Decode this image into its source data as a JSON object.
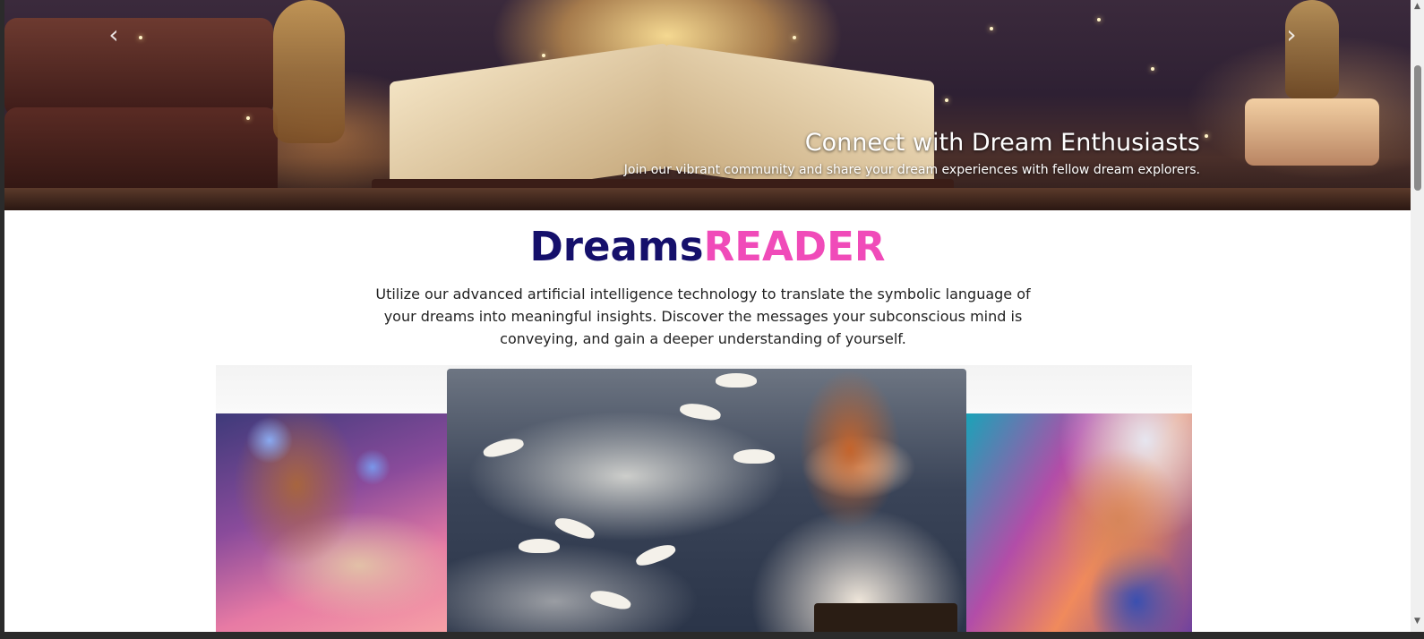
{
  "hero": {
    "prev_arrow": "‹",
    "next_arrow": "›",
    "caption_title": "Connect with Dream Enthusiasts",
    "caption_text": "Join our vibrant community and share your dream experiences with fellow dream explorers."
  },
  "brand": {
    "part1": "Dreams",
    "part2": "READER",
    "color_part1": "#15106b",
    "color_part2": "#f04bb9"
  },
  "intro": {
    "text": "Utilize our advanced artificial intelligence technology to translate the symbolic language of your dreams into meaningful insights. Discover the messages your subconscious mind is conveying, and gain a deeper understanding of yourself."
  },
  "gallery": {
    "images": [
      {
        "name": "dreaming-woman-image"
      },
      {
        "name": "woman-reading-with-doves-image"
      },
      {
        "name": "dreaming-man-image"
      }
    ]
  },
  "scrollbar": {
    "up_icon": "▲",
    "down_icon": "▼"
  }
}
